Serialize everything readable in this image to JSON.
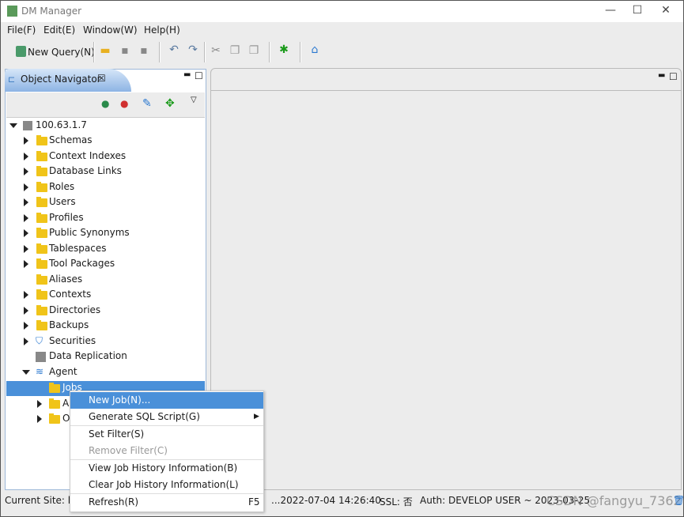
{
  "window": {
    "title": "DM Manager",
    "controls": [
      "—",
      "☐",
      "✕"
    ]
  },
  "menubar": [
    "File(F)",
    "Edit(E)",
    "Window(W)",
    "Help(H)"
  ],
  "toolbar": {
    "new_query": "New Query(N)"
  },
  "navigator": {
    "tab_label": "Object Navigator",
    "root": "100.63.1.7",
    "items": [
      {
        "label": "Schemas",
        "expandable": true,
        "icon": "folder"
      },
      {
        "label": "Context Indexes",
        "expandable": true,
        "icon": "folder"
      },
      {
        "label": "Database Links",
        "expandable": true,
        "icon": "folder"
      },
      {
        "label": "Roles",
        "expandable": true,
        "icon": "folder"
      },
      {
        "label": "Users",
        "expandable": true,
        "icon": "folder"
      },
      {
        "label": "Profiles",
        "expandable": true,
        "icon": "folder"
      },
      {
        "label": "Public Synonyms",
        "expandable": true,
        "icon": "folder"
      },
      {
        "label": "Tablespaces",
        "expandable": true,
        "icon": "folder"
      },
      {
        "label": "Tool Packages",
        "expandable": true,
        "icon": "folder"
      },
      {
        "label": "Aliases",
        "expandable": false,
        "icon": "folder"
      },
      {
        "label": "Contexts",
        "expandable": true,
        "icon": "folder"
      },
      {
        "label": "Directories",
        "expandable": true,
        "icon": "folder"
      },
      {
        "label": "Backups",
        "expandable": true,
        "icon": "folder"
      },
      {
        "label": "Securities",
        "expandable": true,
        "icon": "shield"
      },
      {
        "label": "Data Replication",
        "expandable": false,
        "icon": "replication"
      },
      {
        "label": "Agent",
        "expandable": true,
        "expanded": true,
        "icon": "layers"
      }
    ],
    "agent_children": [
      {
        "label": "Jobs",
        "selected": true
      },
      {
        "label": "A"
      },
      {
        "label": "O"
      }
    ]
  },
  "context_menu": [
    {
      "label": "New Job(N)...",
      "highlighted": true
    },
    {
      "label": "Generate SQL Script(G)",
      "submenu": true
    },
    {
      "separator": true
    },
    {
      "label": "Set Filter(S)"
    },
    {
      "label": "Remove Filter(C)",
      "disabled": true
    },
    {
      "separator": true
    },
    {
      "label": "View Job History Information(B)"
    },
    {
      "label": "Clear Job History Information(L)"
    },
    {
      "separator": true
    },
    {
      "label": "Refresh(R)",
      "shortcut": "F5"
    }
  ],
  "status": {
    "site": "Current Site: lo",
    "time": "...2022-07-04 14:26:40",
    "ssl": "SSL: 否",
    "auth": "Auth: DEVELOP USER ~ 2023-03-25"
  },
  "watermark": "CSDN @fangyu_7362"
}
